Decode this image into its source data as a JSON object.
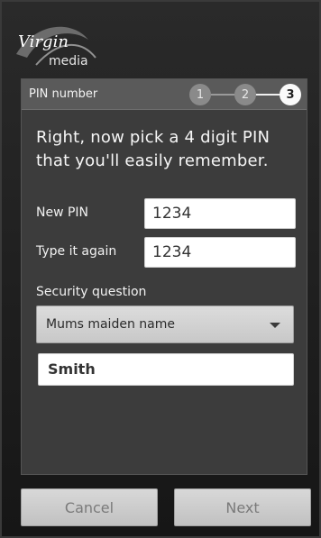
{
  "brand": {
    "logo_text": "Virgin",
    "logo_subtext": "media"
  },
  "panel": {
    "title": "PIN number",
    "steps": [
      "1",
      "2",
      "3"
    ],
    "active_step": 3,
    "heading": "Right, now pick a 4 digit PIN that you'll easily remember."
  },
  "form": {
    "new_pin_label": "New PIN",
    "new_pin_value": "1234",
    "confirm_pin_label": "Type it again",
    "confirm_pin_value": "1234",
    "security_label": "Security question",
    "security_question": "Mums maiden name",
    "security_answer": "Smith"
  },
  "footer": {
    "cancel_label": "Cancel",
    "next_label": "Next"
  },
  "colors": {
    "background": "#1b1b1b",
    "panel": "#3c3c3c",
    "header": "#5a5a5a",
    "active_step": "#fafafa"
  }
}
